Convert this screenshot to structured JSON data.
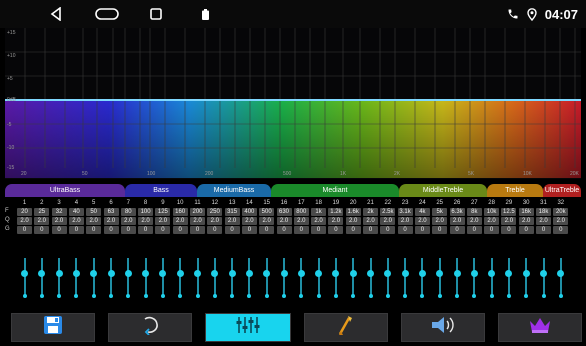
{
  "status": {
    "time": "04:07"
  },
  "graph": {
    "y_labels": [
      "+15",
      "+10",
      "+5",
      "0dB",
      "-5",
      "-10",
      "-15"
    ],
    "x_labels": [
      "20",
      "50",
      "100",
      "200",
      "500",
      "1K",
      "2K",
      "5K",
      "10K",
      "20K"
    ]
  },
  "bands": [
    {
      "label": "UltraBass",
      "color": "#5a2a9a"
    },
    {
      "label": "Bass",
      "color": "#2a2aa8"
    },
    {
      "label": "MediumBass",
      "color": "#1a6aa8"
    },
    {
      "label": "Mediant",
      "color": "#1a8a2a"
    },
    {
      "label": "MiddleTreble",
      "color": "#6a8a18"
    },
    {
      "label": "Treble",
      "color": "#b87a10"
    },
    {
      "label": "UltraTreble",
      "color": "#b02020"
    }
  ],
  "row_labels": {
    "f": "F",
    "q": "Q",
    "g": "G"
  },
  "bands_eq": {
    "numbers": [
      "1",
      "2",
      "3",
      "4",
      "5",
      "6",
      "7",
      "8",
      "9",
      "10",
      "11",
      "12",
      "13",
      "14",
      "15",
      "16",
      "17",
      "18",
      "19",
      "20",
      "21",
      "22",
      "23",
      "24",
      "25",
      "26",
      "27",
      "28",
      "29",
      "30",
      "31",
      "32"
    ],
    "frequencies": [
      "20",
      "25",
      "32",
      "40",
      "50",
      "63",
      "80",
      "100",
      "125",
      "160",
      "200",
      "250",
      "315",
      "400",
      "500",
      "630",
      "800",
      "1k",
      "1.2k",
      "1.6k",
      "2k",
      "2.5k",
      "3.1k",
      "4k",
      "5k",
      "6.3k",
      "8k",
      "10k",
      "12.5",
      "16k",
      "18k",
      "20k"
    ],
    "q": [
      "2.0",
      "2.0",
      "2.0",
      "2.0",
      "2.0",
      "2.0",
      "2.0",
      "2.0",
      "2.0",
      "2.0",
      "2.0",
      "2.0",
      "2.0",
      "2.0",
      "2.0",
      "2.0",
      "2.0",
      "2.0",
      "2.0",
      "2.0",
      "2.0",
      "2.0",
      "2.0",
      "2.0",
      "2.0",
      "2.0",
      "2.0",
      "2.0",
      "2.0",
      "2.0",
      "2.0",
      "2.0"
    ],
    "gain": [
      "0",
      "0",
      "0",
      "0",
      "0",
      "0",
      "0",
      "0",
      "0",
      "0",
      "0",
      "0",
      "0",
      "0",
      "0",
      "0",
      "0",
      "0",
      "0",
      "0",
      "0",
      "0",
      "0",
      "0",
      "0",
      "0",
      "0",
      "0",
      "0",
      "0",
      "0",
      "0"
    ]
  },
  "colors": {
    "accent": "#18d4ee",
    "curve": "#7fd8ff"
  },
  "toolbar": [
    {
      "icon": "save-icon"
    },
    {
      "icon": "reset-icon"
    },
    {
      "icon": "equalizer-icon",
      "active": true
    },
    {
      "icon": "sound-field-icon"
    },
    {
      "icon": "speaker-icon"
    },
    {
      "icon": "crown-icon"
    }
  ]
}
